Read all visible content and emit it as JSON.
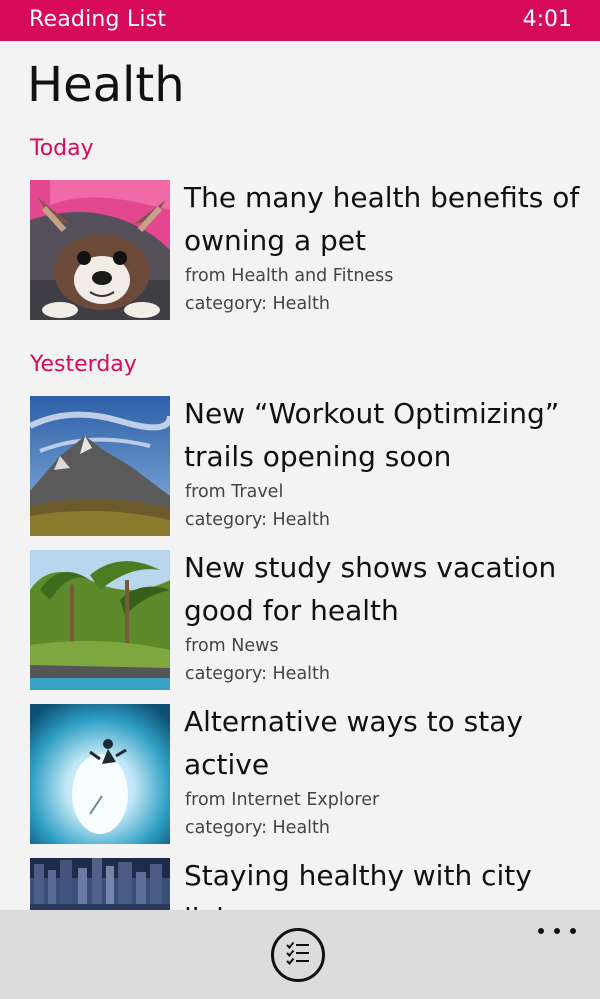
{
  "status_bar": {
    "app_name": "Reading List",
    "time": "4:01",
    "accent_color": "#d80a5b"
  },
  "page": {
    "title": "Health"
  },
  "groups": [
    {
      "header": "Today",
      "articles": [
        {
          "title": "The many health benefits of owning a pet",
          "source": "from Health and Fitness",
          "category": "category: Health",
          "thumbnail": "dog-photo"
        }
      ]
    },
    {
      "header": "Yesterday",
      "articles": [
        {
          "title": "New “Workout Optimizing” trails opening soon",
          "source": "from Travel",
          "category": "category: Health",
          "thumbnail": "mountain-photo"
        },
        {
          "title": "New study shows vacation good for health",
          "source": "from News",
          "category": "category: Health",
          "thumbnail": "palm-beach-photo"
        },
        {
          "title": "Alternative ways to stay active",
          "source": "from Internet Explorer",
          "category": "category: Health",
          "thumbnail": "ice-climbing-photo"
        },
        {
          "title": "Staying healthy with city living",
          "source": "",
          "category": "",
          "thumbnail": "city-skyline-photo"
        }
      ]
    }
  ],
  "app_bar": {
    "primary_icon": "checklist-icon",
    "more_icon": "more-ellipsis-icon"
  }
}
